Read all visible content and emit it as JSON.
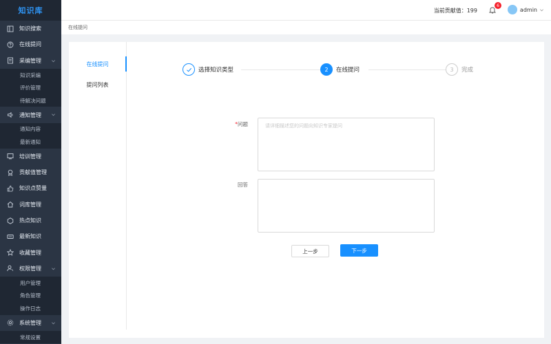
{
  "app": {
    "logo": "知识库"
  },
  "sidebar": {
    "items": [
      {
        "label": "知识搜索",
        "icon": "book-icon"
      },
      {
        "label": "在线提问",
        "icon": "question-circle-icon"
      },
      {
        "label": "采编管理",
        "icon": "edit-doc-icon",
        "expanded": true,
        "children": [
          "知识采编",
          "评价管理",
          "待解决问题"
        ]
      },
      {
        "label": "通知管理",
        "icon": "speaker-icon",
        "expanded": true,
        "children": [
          "通知内容",
          "最新通知"
        ]
      },
      {
        "label": "培训管理",
        "icon": "training-icon"
      },
      {
        "label": "贡献值管理",
        "icon": "award-icon"
      },
      {
        "label": "知识点赞量",
        "icon": "thumbs-up-icon"
      },
      {
        "label": "词库管理",
        "icon": "home-icon"
      },
      {
        "label": "热点知识",
        "icon": "hexagon-icon"
      },
      {
        "label": "最新知识",
        "icon": "new-tag-icon"
      },
      {
        "label": "收藏管理",
        "icon": "star-icon"
      },
      {
        "label": "权限管理",
        "icon": "user-key-icon",
        "expanded": true,
        "children": [
          "用户管理",
          "角色管理",
          "操作日志"
        ]
      },
      {
        "label": "系统管理",
        "icon": "gear-icon",
        "expanded": true,
        "children": [
          "常规设置"
        ]
      }
    ]
  },
  "topbar": {
    "contribution_label": "当前贡献值",
    "contribution_value": "199",
    "contribution_text": "当前贡献值：199",
    "notification_count": "6",
    "username": "admin"
  },
  "breadcrumb": {
    "current": "在线提问"
  },
  "side_nav": {
    "items": [
      {
        "label": "在线提问",
        "active": true
      },
      {
        "label": "提问列表",
        "active": false
      }
    ]
  },
  "steps": [
    {
      "index": "1",
      "title": "选择知识类型",
      "status": "done"
    },
    {
      "index": "2",
      "title": "在线提问",
      "status": "current"
    },
    {
      "index": "3",
      "title": "完成",
      "status": "wait"
    }
  ],
  "form": {
    "question_label": "问题",
    "question_placeholder": "请详细描述您的问题向知识专家提问",
    "question_value": "",
    "answer_label": "回答",
    "answer_value": ""
  },
  "buttons": {
    "prev": "上一步",
    "next": "下一步"
  },
  "colors": {
    "primary": "#1890ff",
    "sidebar_bg": "#2b3544",
    "sidebar_sub_bg": "#1f2733",
    "badge": "#f5222d"
  }
}
